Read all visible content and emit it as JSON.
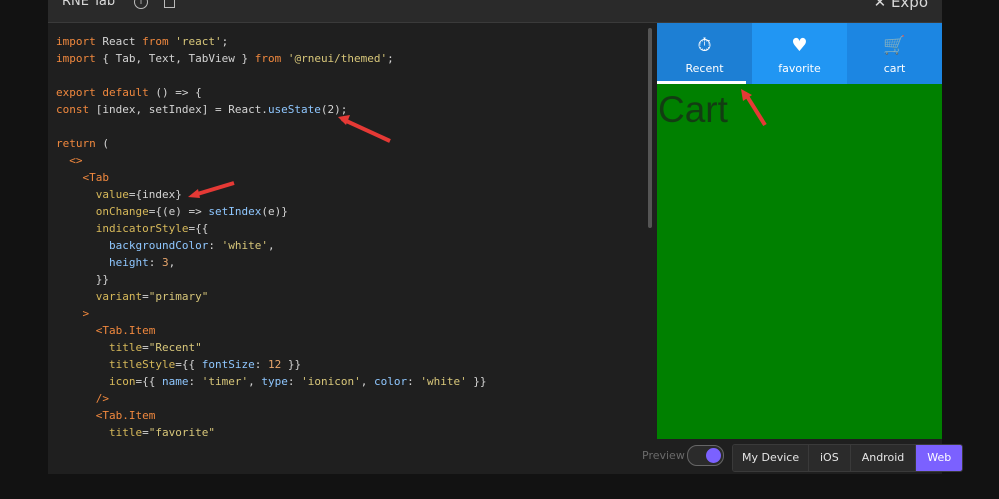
{
  "topbar": {
    "title": "RNE Tab",
    "brand": "Expo"
  },
  "code": {
    "lines": [
      [
        {
          "t": "import",
          "c": "kw"
        },
        {
          "t": " React "
        },
        {
          "t": "from",
          "c": "kw"
        },
        {
          "t": " 'react'",
          "c": "str"
        },
        {
          "t": ";"
        }
      ],
      [
        {
          "t": "import",
          "c": "kw"
        },
        {
          "t": " { Tab, Text, TabView } "
        },
        {
          "t": "from",
          "c": "kw"
        },
        {
          "t": " '@rneui/themed'",
          "c": "str"
        },
        {
          "t": ";"
        }
      ],
      [],
      [
        {
          "t": "export",
          "c": "kw"
        },
        {
          "t": " "
        },
        {
          "t": "default",
          "c": "kw"
        },
        {
          "t": " () => {"
        }
      ],
      [
        {
          "t": "const",
          "c": "kw"
        },
        {
          "t": " [index, setIndex] = React."
        },
        {
          "t": "useState",
          "c": "fn"
        },
        {
          "t": "(2);"
        }
      ],
      [],
      [
        {
          "t": "return",
          "c": "kw"
        },
        {
          "t": " ("
        }
      ],
      [
        {
          "t": "  "
        },
        {
          "t": "<>",
          "c": "tag"
        }
      ],
      [
        {
          "t": "    "
        },
        {
          "t": "<Tab",
          "c": "tag"
        }
      ],
      [
        {
          "t": "      "
        },
        {
          "t": "value",
          "c": "attr"
        },
        {
          "t": "={index}"
        }
      ],
      [
        {
          "t": "      "
        },
        {
          "t": "onChange",
          "c": "attr"
        },
        {
          "t": "={(e) => "
        },
        {
          "t": "setIndex",
          "c": "fn"
        },
        {
          "t": "(e)}"
        }
      ],
      [
        {
          "t": "      "
        },
        {
          "t": "indicatorStyle",
          "c": "attr"
        },
        {
          "t": "={{"
        }
      ],
      [
        {
          "t": "        "
        },
        {
          "t": "backgroundColor",
          "c": "fn"
        },
        {
          "t": ": "
        },
        {
          "t": "'white'",
          "c": "str"
        },
        {
          "t": ","
        }
      ],
      [
        {
          "t": "        "
        },
        {
          "t": "height",
          "c": "fn"
        },
        {
          "t": ": "
        },
        {
          "t": "3",
          "c": "num"
        },
        {
          "t": ","
        }
      ],
      [
        {
          "t": "      }}"
        }
      ],
      [
        {
          "t": "      "
        },
        {
          "t": "variant",
          "c": "attr"
        },
        {
          "t": "="
        },
        {
          "t": "\"primary\"",
          "c": "str"
        }
      ],
      [
        {
          "t": "    "
        },
        {
          "t": ">",
          "c": "tag"
        }
      ],
      [
        {
          "t": "      "
        },
        {
          "t": "<Tab.Item",
          "c": "tag"
        }
      ],
      [
        {
          "t": "        "
        },
        {
          "t": "title",
          "c": "attr"
        },
        {
          "t": "="
        },
        {
          "t": "\"Recent\"",
          "c": "str"
        }
      ],
      [
        {
          "t": "        "
        },
        {
          "t": "titleStyle",
          "c": "attr"
        },
        {
          "t": "={{ "
        },
        {
          "t": "fontSize",
          "c": "fn"
        },
        {
          "t": ": "
        },
        {
          "t": "12",
          "c": "num"
        },
        {
          "t": " }}"
        }
      ],
      [
        {
          "t": "        "
        },
        {
          "t": "icon",
          "c": "attr"
        },
        {
          "t": "={{ "
        },
        {
          "t": "name",
          "c": "fn"
        },
        {
          "t": ": "
        },
        {
          "t": "'timer'",
          "c": "str"
        },
        {
          "t": ", "
        },
        {
          "t": "type",
          "c": "fn"
        },
        {
          "t": ": "
        },
        {
          "t": "'ionicon'",
          "c": "str"
        },
        {
          "t": ", "
        },
        {
          "t": "color",
          "c": "fn"
        },
        {
          "t": ": "
        },
        {
          "t": "'white'",
          "c": "str"
        },
        {
          "t": " }}"
        }
      ],
      [
        {
          "t": "      "
        },
        {
          "t": "/>",
          "c": "tag"
        }
      ],
      [
        {
          "t": "      "
        },
        {
          "t": "<Tab.Item",
          "c": "tag"
        }
      ],
      [
        {
          "t": "        "
        },
        {
          "t": "title",
          "c": "attr"
        },
        {
          "t": "="
        },
        {
          "t": "\"favorite\"",
          "c": "str"
        }
      ]
    ]
  },
  "preview": {
    "tabs": [
      {
        "label": "Recent",
        "icon": "timer-icon",
        "glyph": "⏱"
      },
      {
        "label": "favorite",
        "icon": "heart-icon",
        "glyph": "♥"
      },
      {
        "label": "cart",
        "icon": "cart-icon",
        "glyph": "🛒"
      }
    ],
    "content": "Cart",
    "colors": {
      "tabbar": "#2196f3",
      "content": "#008000"
    }
  },
  "bottom": {
    "preview_label": "Preview",
    "platforms": [
      "My Device",
      "iOS",
      "Android",
      "Web"
    ],
    "selected": "Web"
  }
}
